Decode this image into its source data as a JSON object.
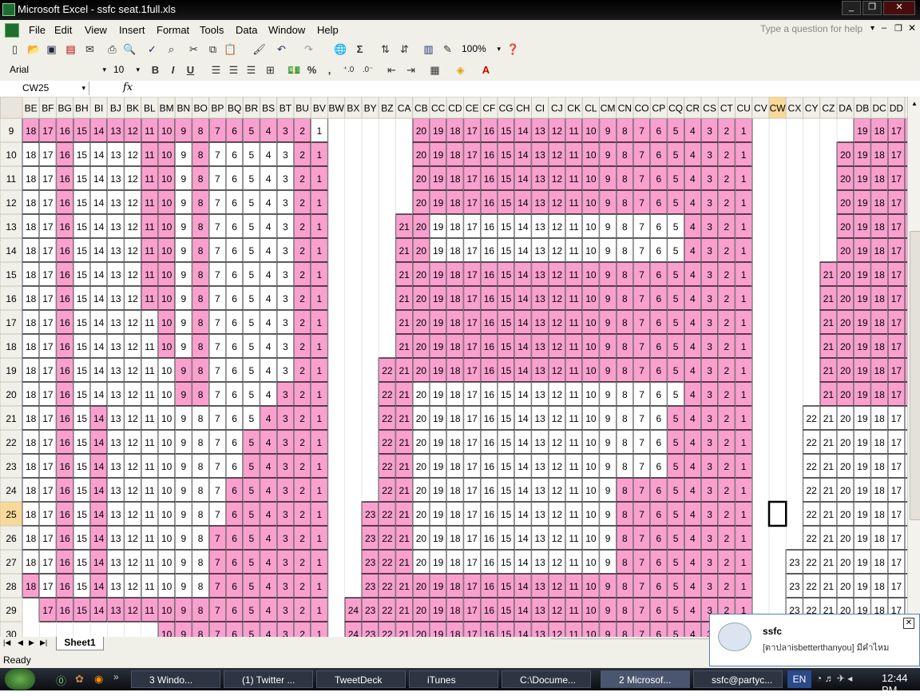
{
  "window": {
    "title": "Microsoft Excel - ssfc seat.1full.xls",
    "min_icon": "minimize-icon",
    "max_icon": "restore-icon",
    "close_icon": "close-icon"
  },
  "menu": {
    "items": [
      "File",
      "Edit",
      "View",
      "Insert",
      "Format",
      "Tools",
      "Data",
      "Window",
      "Help"
    ],
    "ask_placeholder": "Type a question for help"
  },
  "toolbar1": {
    "zoom": "100%"
  },
  "toolbar2": {
    "font": "Arial",
    "size": "10",
    "bold": "B",
    "italic": "I",
    "underline": "U",
    "currency": "%",
    "comma": ","
  },
  "formula_bar": {
    "name_box": "CW25",
    "fx": "fx",
    "content": ""
  },
  "grid": {
    "columns": [
      "BE",
      "BF",
      "BG",
      "BH",
      "BI",
      "BJ",
      "BK",
      "BL",
      "BM",
      "BN",
      "BO",
      "BP",
      "BQ",
      "BR",
      "BS",
      "BT",
      "BU",
      "BV",
      "BW",
      "BX",
      "BY",
      "BZ",
      "CA",
      "CB",
      "CC",
      "CD",
      "CE",
      "CF",
      "CG",
      "CH",
      "CI",
      "CJ",
      "CK",
      "CL",
      "CM",
      "CN",
      "CO",
      "CP",
      "CQ",
      "CR",
      "CS",
      "CT",
      "CU",
      "CV",
      "CW",
      "CX",
      "CY",
      "CZ",
      "DA",
      "DB",
      "DC",
      "DD",
      "DE"
    ],
    "selected_column": "CW",
    "selected_row": 25,
    "active_cell": "CW25",
    "pink": "#f9a0cf",
    "rows": [
      {
        "row": 9,
        "first": "BE",
        "last": "BV",
        "start": 18,
        "pink": [
          "BE",
          "BF",
          "BG",
          "BH",
          "BI",
          "BJ",
          "BK",
          "BL",
          "BM",
          "BN",
          "BO",
          "BP",
          "BQ",
          "BR",
          "BS",
          "BT",
          "BU"
        ],
        "block2_first": "CB",
        "block2_start": 20,
        "block2_pink": [
          "CB",
          "CC",
          "CD",
          "CE",
          "CF",
          "CG",
          "CH",
          "CI",
          "CJ",
          "CK",
          "CL",
          "CM",
          "CN",
          "CO",
          "CP",
          "CQ",
          "CR",
          "CS",
          "CT",
          "CU"
        ],
        "block3_first": "DB",
        "block3_start": 19,
        "block3_pink": [
          "DB",
          "DC",
          "DD",
          "DE"
        ]
      },
      {
        "row": 10,
        "first": "BE",
        "last": "BV",
        "start": 18,
        "pink": [
          "BG",
          "BL",
          "BM",
          "BO",
          "BU",
          "BV"
        ],
        "block2_first": "CB",
        "block2_start": 20,
        "block2_pink": [
          "CB",
          "CC",
          "CD",
          "CE",
          "CF",
          "CG",
          "CH",
          "CI",
          "CJ",
          "CK",
          "CL",
          "CM",
          "CN",
          "CO",
          "CP",
          "CQ",
          "CR",
          "CS",
          "CT",
          "CU"
        ],
        "block3_first": "DA",
        "block3_start": 20,
        "block3_pink": [
          "DA",
          "DB",
          "DC",
          "DD",
          "DE"
        ]
      },
      {
        "row": 11,
        "first": "BE",
        "last": "BV",
        "start": 18,
        "pink": [
          "BG",
          "BL",
          "BM",
          "BO",
          "BU",
          "BV"
        ],
        "block2_first": "CB",
        "block2_start": 20,
        "block2_pink": [
          "CB",
          "CC",
          "CD",
          "CE",
          "CF",
          "CG",
          "CH",
          "CI",
          "CJ",
          "CK",
          "CL",
          "CM",
          "CN",
          "CO",
          "CP",
          "CQ",
          "CR",
          "CS",
          "CT",
          "CU"
        ],
        "block3_first": "DA",
        "block3_start": 20,
        "block3_pink": [
          "DA",
          "DB",
          "DC",
          "DD",
          "DE"
        ]
      },
      {
        "row": 12,
        "first": "BE",
        "last": "BV",
        "start": 18,
        "pink": [
          "BG",
          "BL",
          "BM",
          "BO",
          "BU",
          "BV"
        ],
        "block2_first": "CB",
        "block2_start": 20,
        "block2_pink": [
          "CB",
          "CC",
          "CD",
          "CE",
          "CF",
          "CG",
          "CH",
          "CI",
          "CJ",
          "CK",
          "CL",
          "CM",
          "CN",
          "CO",
          "CP",
          "CQ",
          "CR",
          "CS",
          "CT",
          "CU"
        ],
        "block3_first": "DA",
        "block3_start": 20,
        "block3_pink": [
          "DA",
          "DB",
          "DC",
          "DD",
          "DE"
        ]
      },
      {
        "row": 13,
        "first": "BE",
        "last": "BV",
        "start": 18,
        "pink": [
          "BG",
          "BL",
          "BM",
          "BO",
          "BU",
          "BV"
        ],
        "block2_first": "CA",
        "block2_start": 21,
        "block2_pink": [
          "CA",
          "CB",
          "CR",
          "CS",
          "CT",
          "CU"
        ],
        "block3_first": "DA",
        "block3_start": 20,
        "block3_pink": [
          "DA",
          "DB",
          "DC",
          "DD",
          "DE"
        ]
      },
      {
        "row": 14,
        "first": "BE",
        "last": "BV",
        "start": 18,
        "pink": [
          "BG",
          "BL",
          "BM",
          "BO",
          "BU",
          "BV"
        ],
        "block2_first": "CA",
        "block2_start": 21,
        "block2_pink": [
          "CA",
          "CB",
          "CR",
          "CS",
          "CT",
          "CU"
        ],
        "block3_first": "DA",
        "block3_start": 20,
        "block3_pink": [
          "DA",
          "DB",
          "DC",
          "DD",
          "DE"
        ]
      },
      {
        "row": 15,
        "first": "BE",
        "last": "BV",
        "start": 18,
        "pink": [
          "BG",
          "BL",
          "BM",
          "BO",
          "BU",
          "BV"
        ],
        "block2_first": "CA",
        "block2_start": 21,
        "block2_pink": [
          "CA",
          "CB",
          "CC",
          "CD",
          "CE",
          "CF",
          "CG",
          "CH",
          "CI",
          "CJ",
          "CK",
          "CL",
          "CM",
          "CN",
          "CO",
          "CP",
          "CQ",
          "CR",
          "CS",
          "CT",
          "CU"
        ],
        "block3_first": "CZ",
        "block3_start": 21,
        "block3_pink": [
          "CZ",
          "DA",
          "DB",
          "DC",
          "DD",
          "DE"
        ]
      },
      {
        "row": 16,
        "first": "BE",
        "last": "BV",
        "start": 18,
        "pink": [
          "BG",
          "BL",
          "BM",
          "BO",
          "BU",
          "BV"
        ],
        "block2_first": "CA",
        "block2_start": 21,
        "block2_pink": [
          "CA",
          "CB",
          "CC",
          "CD",
          "CE",
          "CF",
          "CG",
          "CH",
          "CI",
          "CJ",
          "CK",
          "CL",
          "CM",
          "CN",
          "CO",
          "CP",
          "CQ",
          "CR",
          "CS",
          "CT",
          "CU"
        ],
        "block3_first": "CZ",
        "block3_start": 21,
        "block3_pink": [
          "CZ",
          "DA",
          "DB",
          "DC",
          "DD",
          "DE"
        ]
      },
      {
        "row": 17,
        "first": "BE",
        "last": "BV",
        "start": 18,
        "pink": [
          "BG",
          "BM",
          "BO",
          "BU",
          "BV"
        ],
        "block2_first": "CA",
        "block2_start": 21,
        "block2_pink": [
          "CA",
          "CB",
          "CC",
          "CD",
          "CE",
          "CF",
          "CG",
          "CH",
          "CI",
          "CJ",
          "CK",
          "CL",
          "CM",
          "CN",
          "CO",
          "CP",
          "CQ",
          "CR",
          "CS",
          "CT",
          "CU"
        ],
        "block3_first": "CZ",
        "block3_start": 21,
        "block3_pink": [
          "CZ",
          "DA",
          "DB",
          "DC",
          "DD",
          "DE"
        ]
      },
      {
        "row": 18,
        "first": "BE",
        "last": "BV",
        "start": 18,
        "pink": [
          "BG",
          "BM",
          "BO",
          "BU",
          "BV"
        ],
        "block2_first": "CA",
        "block2_start": 21,
        "block2_pink": [
          "CA",
          "CB",
          "CC",
          "CD",
          "CE",
          "CF",
          "CG",
          "CH",
          "CI",
          "CJ",
          "CK",
          "CL",
          "CM",
          "CN",
          "CO",
          "CP",
          "CQ",
          "CR",
          "CS",
          "CT",
          "CU"
        ],
        "block3_first": "CZ",
        "block3_start": 21,
        "block3_pink": [
          "CZ",
          "DA",
          "DB",
          "DC",
          "DD",
          "DE"
        ]
      },
      {
        "row": 19,
        "first": "BE",
        "last": "BV",
        "start": 18,
        "pink": [
          "BG",
          "BN",
          "BO",
          "BU",
          "BV"
        ],
        "block2_first": "BZ",
        "block2_start": 22,
        "block2_pink": [
          "BZ",
          "CA",
          "CB",
          "CC",
          "CD",
          "CE",
          "CF",
          "CG",
          "CH",
          "CI",
          "CJ",
          "CK",
          "CL",
          "CM",
          "CN",
          "CO",
          "CP",
          "CQ",
          "CR",
          "CS",
          "CT",
          "CU"
        ],
        "block3_first": "CZ",
        "block3_start": 21,
        "block3_pink": [
          "CZ",
          "DA",
          "DB",
          "DC",
          "DD",
          "DE"
        ]
      },
      {
        "row": 20,
        "first": "BE",
        "last": "BV",
        "start": 18,
        "pink": [
          "BG",
          "BN",
          "BO",
          "BT",
          "BU",
          "BV"
        ],
        "block2_first": "BZ",
        "block2_start": 22,
        "block2_pink": [
          "BZ",
          "CA",
          "CR",
          "CS",
          "CT",
          "CU"
        ],
        "block3_first": "CZ",
        "block3_start": 21,
        "block3_pink": [
          "CZ",
          "DA",
          "DB",
          "DC",
          "DD",
          "DE"
        ]
      },
      {
        "row": 21,
        "first": "BE",
        "last": "BV",
        "start": 18,
        "pink": [
          "BG",
          "BI",
          "BS",
          "BT",
          "BU",
          "BV"
        ],
        "block2_first": "BZ",
        "block2_start": 22,
        "block2_pink": [
          "BZ",
          "CA",
          "CQ",
          "CR",
          "CS",
          "CT",
          "CU"
        ],
        "block3_first": "CY",
        "block3_start": 22,
        "block3_pink": []
      },
      {
        "row": 22,
        "first": "BE",
        "last": "BV",
        "start": 18,
        "pink": [
          "BG",
          "BI",
          "BR",
          "BS",
          "BT",
          "BU",
          "BV"
        ],
        "block2_first": "BZ",
        "block2_start": 22,
        "block2_pink": [
          "BZ",
          "CA",
          "CQ",
          "CR",
          "CS",
          "CT",
          "CU"
        ],
        "block3_first": "CY",
        "block3_start": 22,
        "block3_pink": []
      },
      {
        "row": 23,
        "first": "BE",
        "last": "BV",
        "start": 18,
        "pink": [
          "BG",
          "BI",
          "BR",
          "BS",
          "BT",
          "BU",
          "BV"
        ],
        "block2_first": "BZ",
        "block2_start": 22,
        "block2_pink": [
          "BZ",
          "CA",
          "CQ",
          "CR",
          "CS",
          "CT",
          "CU"
        ],
        "block3_first": "CY",
        "block3_start": 22,
        "block3_pink": []
      },
      {
        "row": 24,
        "first": "BE",
        "last": "BV",
        "start": 18,
        "pink": [
          "BG",
          "BI",
          "BQ",
          "BR",
          "BS",
          "BT",
          "BU",
          "BV"
        ],
        "block2_first": "BZ",
        "block2_start": 22,
        "block2_pink": [
          "BZ",
          "CA",
          "CN",
          "CO",
          "CP",
          "CQ",
          "CR",
          "CS",
          "CT",
          "CU"
        ],
        "block3_first": "CY",
        "block3_start": 22,
        "block3_pink": []
      },
      {
        "row": 25,
        "first": "BE",
        "last": "BV",
        "start": 18,
        "pink": [
          "BG",
          "BI",
          "BQ",
          "BR",
          "BS",
          "BT",
          "BU",
          "BV"
        ],
        "block2_first": "BY",
        "block2_start": 23,
        "block2_pink": [
          "BY",
          "BZ",
          "CA",
          "CN",
          "CO",
          "CP",
          "CQ",
          "CR",
          "CS",
          "CT",
          "CU"
        ],
        "block3_first": "CY",
        "block3_start": 22,
        "block3_pink": []
      },
      {
        "row": 26,
        "first": "BE",
        "last": "BV",
        "start": 18,
        "pink": [
          "BG",
          "BI",
          "BP",
          "BQ",
          "BR",
          "BS",
          "BT",
          "BU",
          "BV"
        ],
        "block2_first": "BY",
        "block2_start": 23,
        "block2_pink": [
          "BY",
          "BZ",
          "CA",
          "CN",
          "CO",
          "CP",
          "CQ",
          "CR",
          "CS",
          "CT",
          "CU"
        ],
        "block3_first": "CY",
        "block3_start": 22,
        "block3_pink": []
      },
      {
        "row": 27,
        "first": "BE",
        "last": "BV",
        "start": 18,
        "pink": [
          "BG",
          "BI",
          "BP",
          "BQ",
          "BR",
          "BS",
          "BT",
          "BU",
          "BV"
        ],
        "block2_first": "BY",
        "block2_start": 23,
        "block2_pink": [
          "BY",
          "BZ",
          "CA",
          "CN",
          "CO",
          "CP",
          "CQ",
          "CR",
          "CS",
          "CT",
          "CU"
        ],
        "block3_first": "CX",
        "block3_start": 23,
        "block3_pink": []
      },
      {
        "row": 28,
        "first": "BE",
        "last": "BV",
        "start": 18,
        "pink": [
          "BE",
          "BG",
          "BI",
          "BP",
          "BQ",
          "BR",
          "BS",
          "BT",
          "BU",
          "BV"
        ],
        "block2_first": "BY",
        "block2_start": 23,
        "block2_pink": [
          "BY",
          "BZ",
          "CA",
          "CB",
          "CC",
          "CD",
          "CE",
          "CF",
          "CG",
          "CH",
          "CI",
          "CJ",
          "CK",
          "CL",
          "CM",
          "CN",
          "CO",
          "CP",
          "CQ",
          "CR",
          "CS",
          "CT",
          "CU"
        ],
        "block3_first": "CX",
        "block3_start": 23,
        "block3_pink": []
      },
      {
        "row": 29,
        "first": "BF",
        "last": "BV",
        "start": 17,
        "pink": [
          "BF",
          "BG",
          "BH",
          "BI",
          "BJ",
          "BK",
          "BL",
          "BM",
          "BN",
          "BO",
          "BP",
          "BQ",
          "BR",
          "BS",
          "BT",
          "BU",
          "BV"
        ],
        "block2_first": "BX",
        "block2_start": 24,
        "block2_pink": [
          "BX",
          "BY",
          "BZ",
          "CA",
          "CB",
          "CC",
          "CD",
          "CE",
          "CF",
          "CG",
          "CH",
          "CI",
          "CJ",
          "CK",
          "CL",
          "CM",
          "CN",
          "CO",
          "CP",
          "CQ",
          "CR",
          "CS",
          "CT",
          "CU"
        ],
        "block3_first": "CX",
        "block3_start": 23,
        "block3_pink": []
      },
      {
        "row": 30,
        "first": "BM",
        "last": "BV",
        "start": 10,
        "pink": [
          "BM",
          "BN",
          "BO",
          "BP",
          "BQ",
          "BR",
          "BS",
          "BT",
          "BU",
          "BV"
        ],
        "block2_first": "BX",
        "block2_start": 24,
        "block2_pink": [
          "BX",
          "BY",
          "BZ",
          "CA",
          "CB",
          "CC",
          "CD",
          "CE",
          "CF",
          "CG",
          "CH",
          "CI",
          "CJ",
          "CK",
          "CL",
          "CM",
          "CN",
          "CO",
          "CP",
          "CQ",
          "CR",
          "CS",
          "CT",
          "CU"
        ],
        "block3_first": "",
        "block3_start": 0,
        "block3_pink": []
      }
    ]
  },
  "sheet_tabs": {
    "active": "Sheet1"
  },
  "status": {
    "text": "Ready"
  },
  "notification": {
    "title": "ssfc",
    "message": "[ตาปลาisbetterthanyou] มีคำไหม"
  },
  "taskbar": {
    "buttons": [
      "3 Windo...",
      "(1) Twitter ...",
      "TweetDeck",
      "iTunes",
      "C:\\Docume...",
      "2 Microsof...",
      "ssfc@partyc..."
    ],
    "lang": "EN",
    "clock": "12:44 PM"
  }
}
